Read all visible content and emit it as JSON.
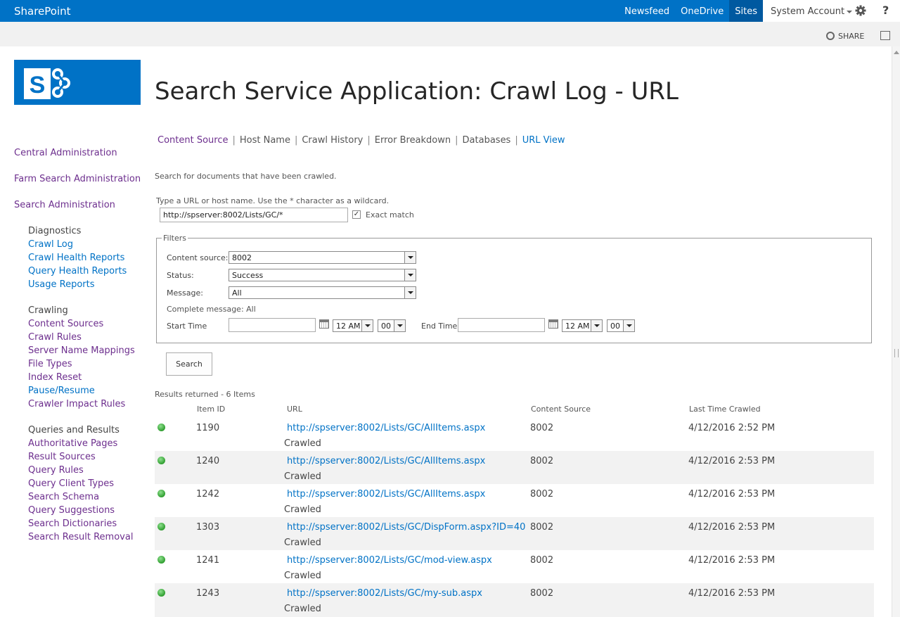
{
  "suite": {
    "brand": "SharePoint",
    "links": [
      "Newsfeed",
      "OneDrive",
      "Sites"
    ],
    "account": "System Account",
    "help": "?"
  },
  "ribbon": {
    "share": "SHARE"
  },
  "page_title": "Search Service Application: Crawl Log - URL",
  "leftnav": {
    "top": [
      "Central Administration",
      "Farm Search Administration",
      "Search Administration"
    ],
    "groups": [
      {
        "heading": "Diagnostics",
        "items": [
          "Crawl Log",
          "Crawl Health Reports",
          "Query Health Reports",
          "Usage Reports"
        ]
      },
      {
        "heading": "Crawling",
        "items": [
          "Content Sources",
          "Crawl Rules",
          "Server Name Mappings",
          "File Types",
          "Index Reset",
          "Pause/Resume",
          "Crawler Impact Rules"
        ]
      },
      {
        "heading": "Queries and Results",
        "items": [
          "Authoritative Pages",
          "Result Sources",
          "Query Rules",
          "Query Client Types",
          "Search Schema",
          "Query Suggestions",
          "Search Dictionaries",
          "Search Result Removal"
        ]
      }
    ]
  },
  "tabs": [
    "Content Source",
    "Host Name",
    "Crawl History",
    "Error Breakdown",
    "Databases",
    "URL View"
  ],
  "search_form": {
    "intro": "Search for documents that have been crawled.",
    "url_label": "Type a URL or host name. Use the * character as a wildcard.",
    "url_value": "http://spserver:8002/Lists/GC/*",
    "exact_match_label": "Exact match",
    "exact_match_checked": true,
    "filters_legend": "Filters",
    "content_source_label": "Content source:",
    "content_source_value": "8002",
    "status_label": "Status:",
    "status_value": "Success",
    "message_label": "Message:",
    "message_value": "All",
    "complete_message_label": "Complete message:",
    "complete_message_value": "All",
    "start_time_label": "Start Time",
    "end_time_label": "End Time",
    "hour_value": "12 AM",
    "minute_value": "00",
    "search_button": "Search"
  },
  "results": {
    "count_text": "Results returned - 6 Items",
    "columns": [
      "Item ID",
      "URL",
      "Content Source",
      "Last Time Crawled"
    ],
    "status_color": "#2f9e2f",
    "rows": [
      {
        "id": "1190",
        "url": "http://spserver:8002/Lists/GC/AllItems.aspx",
        "source": "8002",
        "time": "4/12/2016 2:52 PM",
        "message": "Crawled"
      },
      {
        "id": "1240",
        "url": "http://spserver:8002/Lists/GC/AllItems.aspx",
        "source": "8002",
        "time": "4/12/2016 2:53 PM",
        "message": "Crawled"
      },
      {
        "id": "1242",
        "url": "http://spserver:8002/Lists/GC/AllItems.aspx",
        "source": "8002",
        "time": "4/12/2016 2:53 PM",
        "message": "Crawled"
      },
      {
        "id": "1303",
        "url": "http://spserver:8002/Lists/GC/DispForm.aspx?ID=40",
        "source": "8002",
        "time": "4/12/2016 2:53 PM",
        "message": "Crawled"
      },
      {
        "id": "1241",
        "url": "http://spserver:8002/Lists/GC/mod-view.aspx",
        "source": "8002",
        "time": "4/12/2016 2:53 PM",
        "message": "Crawled"
      },
      {
        "id": "1243",
        "url": "http://spserver:8002/Lists/GC/my-sub.aspx",
        "source": "8002",
        "time": "4/12/2016 2:53 PM",
        "message": "Crawled"
      }
    ]
  },
  "colors": {
    "brand_blue": "#0072c6",
    "visited_purple": "#6d2f8e"
  }
}
